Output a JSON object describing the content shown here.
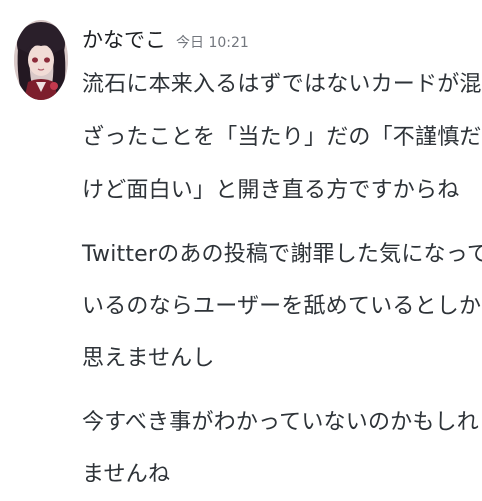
{
  "header": {
    "username": "かなでこ",
    "timestamp": "今日 10:21"
  },
  "avatar": {
    "icon": "avatar-image"
  },
  "messages": [
    {
      "lines": [
        "流石に本来入るはずではないカードが混",
        "ざったことを「当たり」だの「不謹慎だ",
        "けど面白い」と開き直る方ですからね"
      ]
    },
    {
      "lines": [
        "Twitterのあの投稿で謝罪した気になって",
        "いるのならユーザーを舐めているとしか",
        "思えませんし"
      ]
    },
    {
      "lines": [
        "今すべき事がわかっていないのかもしれ",
        "ませんね"
      ]
    }
  ]
}
